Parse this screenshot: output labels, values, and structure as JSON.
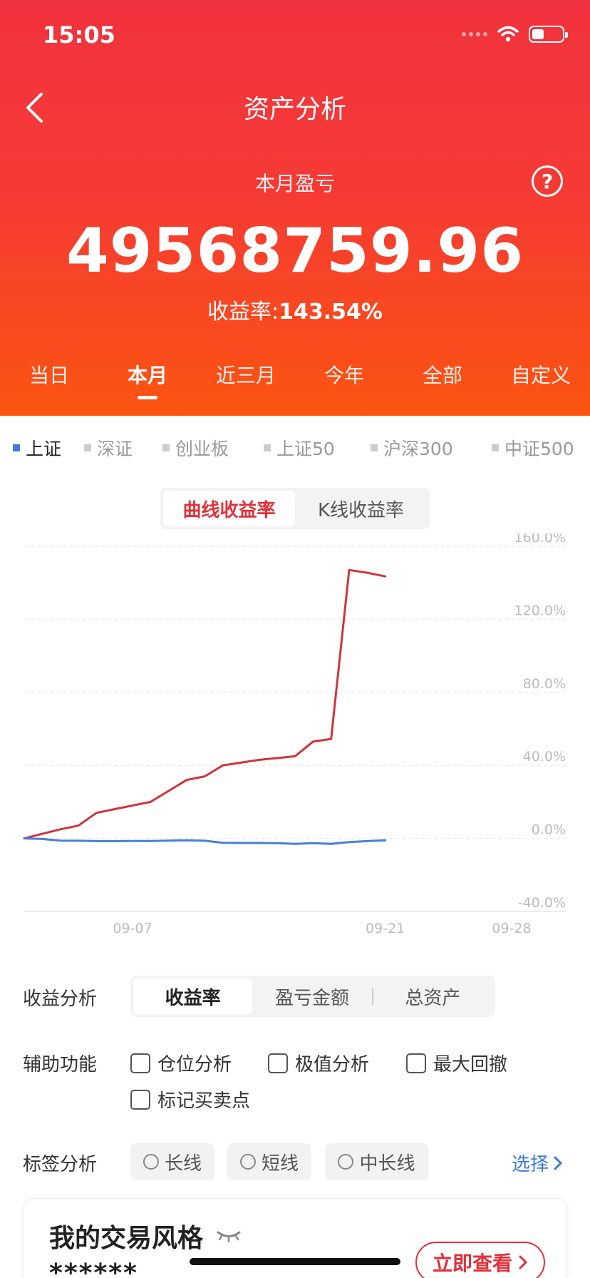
{
  "status": {
    "time": "15:05"
  },
  "header": {
    "title": "资产分析",
    "sub_label": "本月盈亏",
    "help": "?",
    "amount": "49568759.96",
    "rate_label": "收益率:",
    "rate_value": "143.54%"
  },
  "period_tabs": [
    {
      "label": "当日"
    },
    {
      "label": "本月",
      "active": true
    },
    {
      "label": "近三月"
    },
    {
      "label": "今年"
    },
    {
      "label": "全部"
    },
    {
      "label": "自定义"
    }
  ],
  "indices": [
    {
      "label": "上证",
      "active": true
    },
    {
      "label": "深证"
    },
    {
      "label": "创业板"
    },
    {
      "label": "上证50"
    },
    {
      "label": "沪深300"
    },
    {
      "label": "中证500"
    }
  ],
  "curve_toggle": {
    "curve": "曲线收益率",
    "kline": "K线收益率"
  },
  "chart_data": {
    "type": "line",
    "ylim": [
      -40,
      160
    ],
    "y_ticks": [
      "160.0%",
      "120.0%",
      "80.0%",
      "40.0%",
      "0.0%",
      "-40.0%"
    ],
    "x_ticks": [
      "09-07",
      "09-21",
      "09-28"
    ],
    "x_domain": [
      1,
      31
    ],
    "colors": {
      "portfolio": "#d1343c",
      "index": "#4a7fd6"
    },
    "series": [
      {
        "x": [
          1,
          2,
          3,
          4,
          5,
          6,
          7,
          8,
          9,
          10,
          11,
          12,
          13,
          14,
          15,
          16,
          17,
          18,
          19,
          20,
          21
        ],
        "values": [
          0,
          2.5,
          5,
          7,
          14,
          16,
          18,
          20,
          26,
          32,
          34,
          40,
          41.5,
          43,
          44,
          45,
          53,
          54.5,
          147,
          145.5,
          143.5
        ]
      },
      {
        "x": [
          1,
          2,
          3,
          4,
          5,
          6,
          7,
          8,
          9,
          10,
          11,
          12,
          13,
          14,
          15,
          16,
          17,
          18,
          19,
          20,
          21
        ],
        "values": [
          0,
          -0.3,
          -1.2,
          -1.3,
          -1.5,
          -1.5,
          -1.4,
          -1.4,
          -1.2,
          -1.0,
          -1.3,
          -2.4,
          -2.5,
          -2.5,
          -2.6,
          -3.0,
          -2.6,
          -3.0,
          -2.0,
          -1.5,
          -1.0
        ]
      }
    ]
  },
  "analysis": {
    "profit_label": "收益分析",
    "profit_tabs": [
      {
        "label": "收益率",
        "active": true
      },
      {
        "label": "盈亏金额"
      },
      {
        "label": "总资产"
      }
    ],
    "aux_label": "辅助功能",
    "aux_checks": [
      "仓位分析",
      "极值分析",
      "最大回撤",
      "标记买卖点"
    ],
    "tag_label": "标签分析",
    "tags": [
      "长线",
      "短线",
      "中长线"
    ],
    "select_link": "选择"
  },
  "style_card": {
    "title": "我的交易风格",
    "mask": "******",
    "view_button": "立即查看"
  }
}
